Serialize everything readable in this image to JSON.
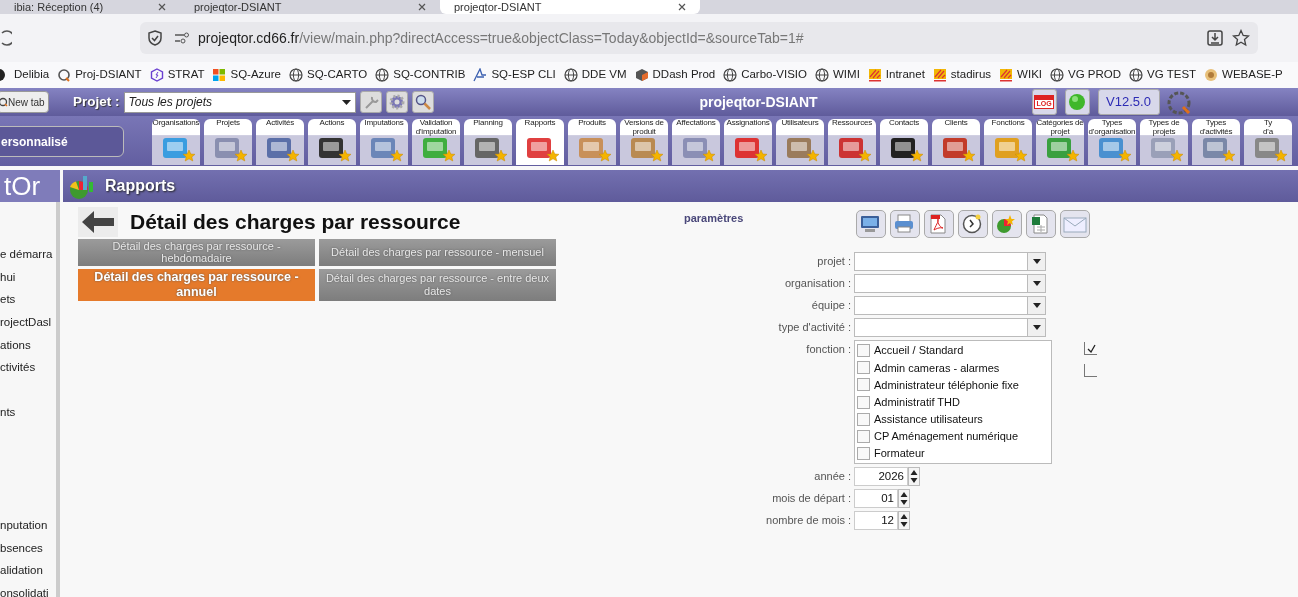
{
  "browser": {
    "tabs": [
      {
        "title": "ibia: Réception (4)",
        "selected": false
      },
      {
        "title": "projeqtor-DSIANT",
        "selected": false
      },
      {
        "title": "projeqtor-DSIANT",
        "selected": true
      }
    ],
    "url": {
      "host": "projeqtor.cd66.fr",
      "path": "/view/main.php?directAccess=true&objectClass=Today&objectId=&sourceTab=1#"
    },
    "bookmarks": [
      {
        "label": "Delibia",
        "kind": "dot"
      },
      {
        "label": "Proj-DSIANT",
        "kind": "q"
      },
      {
        "label": "STRAT",
        "kind": "hex"
      },
      {
        "label": "SQ-Azure",
        "kind": "squares"
      },
      {
        "label": "SQ-CARTO",
        "kind": "globe"
      },
      {
        "label": "SQ-CONTRIB",
        "kind": "globe"
      },
      {
        "label": "SQ-ESP CLI",
        "kind": "swoosh"
      },
      {
        "label": "DDE VM",
        "kind": "globe"
      },
      {
        "label": "DDash Prod",
        "kind": "cube"
      },
      {
        "label": "Carbo-VISIO",
        "kind": "globe"
      },
      {
        "label": "WIMI",
        "kind": "globe"
      },
      {
        "label": "Intranet",
        "kind": "stripes"
      },
      {
        "label": "stadirus",
        "kind": "stripes"
      },
      {
        "label": "WIKI",
        "kind": "stripes"
      },
      {
        "label": "VG PROD",
        "kind": "globe"
      },
      {
        "label": "VG TEST",
        "kind": "globe"
      },
      {
        "label": "WEBASE-P",
        "kind": "flower"
      }
    ]
  },
  "app": {
    "new_tab": "New tab",
    "project_label": "Projet :",
    "project_value": "Tous les projets",
    "title": "projeqtor-DSIANT",
    "log": "LOG",
    "version": "V12.5.0"
  },
  "menu": {
    "view_button": "ersonnalisé",
    "items": [
      {
        "label": "Organisations",
        "selected": false
      },
      {
        "label": "Projets",
        "selected": false
      },
      {
        "label": "Activités",
        "selected": false
      },
      {
        "label": "Actions",
        "selected": false
      },
      {
        "label": "Imputations",
        "selected": false
      },
      {
        "label": "Validation d'imputation",
        "selected": false
      },
      {
        "label": "Planning",
        "selected": false
      },
      {
        "label": "Rapports",
        "selected": true
      },
      {
        "label": "Produits",
        "selected": false
      },
      {
        "label": "Versions de produit",
        "selected": false
      },
      {
        "label": "Affectations",
        "selected": false
      },
      {
        "label": "Assignations",
        "selected": false
      },
      {
        "label": "Utilisateurs",
        "selected": false
      },
      {
        "label": "Ressources",
        "selected": false
      },
      {
        "label": "Contacts",
        "selected": false
      },
      {
        "label": "Clients",
        "selected": false
      },
      {
        "label": "Fonctions",
        "selected": false
      },
      {
        "label": "Catégories de projet",
        "selected": false
      },
      {
        "label": "Types d'organisation",
        "selected": false
      },
      {
        "label": "Types de projets",
        "selected": false
      },
      {
        "label": "Types d'activités",
        "selected": false
      },
      {
        "label": "Ty d'a",
        "selected": false
      }
    ]
  },
  "section": {
    "logo": "tOr",
    "title": "Rapports"
  },
  "sidebar": {
    "groups": [
      {
        "items": [
          "e démarra",
          "hui",
          "ets",
          "rojectDasl",
          "ations",
          "ctivités"
        ]
      },
      {
        "items": [
          "nts"
        ]
      },
      {
        "items": [
          "nputation",
          "bsences",
          "alidation",
          "onsolidati"
        ]
      }
    ]
  },
  "report": {
    "title": "Détail des charges par ressource",
    "variants": [
      {
        "label": "Détail des charges par ressource - hebdomadaire",
        "selected": false
      },
      {
        "label": "Détail des charges par ressource - mensuel",
        "selected": false
      },
      {
        "label": "Détail des charges par ressource - annuel",
        "selected": true
      },
      {
        "label": "Détail des charges par ressource - entre deux dates",
        "selected": false
      }
    ]
  },
  "parameters": {
    "title": "paramètres",
    "fields": [
      {
        "label": "projet :",
        "kind": "select"
      },
      {
        "label": "organisation :",
        "kind": "select"
      },
      {
        "label": "équipe :",
        "kind": "select"
      },
      {
        "label": "type d'activité :",
        "kind": "select"
      },
      {
        "label": "fonction :",
        "kind": "checklist",
        "options": [
          {
            "label": "Accueil / Standard",
            "checked": false
          },
          {
            "label": "Admin cameras - alarmes",
            "checked": false
          },
          {
            "label": "Administrateur téléphonie fixe",
            "checked": false
          },
          {
            "label": "Administratif THD",
            "checked": false
          },
          {
            "label": "Assistance utilisateurs",
            "checked": false
          },
          {
            "label": "CP Aménagement numérique",
            "checked": false
          },
          {
            "label": "Formateur",
            "checked": false
          }
        ],
        "extra_checks": [
          {
            "checked": true
          },
          {
            "checked": false
          }
        ]
      },
      {
        "label": "année :",
        "kind": "spinner",
        "value": "2026"
      },
      {
        "label": "mois de départ :",
        "kind": "spinner",
        "value": "01"
      },
      {
        "label": "nombre de mois :",
        "kind": "spinner",
        "value": "12"
      }
    ]
  }
}
